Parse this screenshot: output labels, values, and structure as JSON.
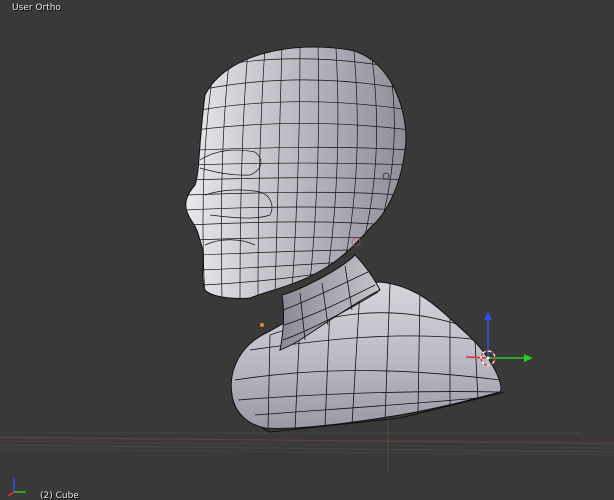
{
  "viewport": {
    "view_name": "User Ortho",
    "object_info": "(2) Cube",
    "background_color": "#393939"
  },
  "mesh": {
    "name": "Cube",
    "shading": "solid",
    "wireframe_overlay": true,
    "surface_color": "#c9c9cf",
    "wire_color": "#000000"
  },
  "transform_gizmo": {
    "x_axis_color": "#e03030",
    "y_axis_color": "#22cc22",
    "z_axis_color": "#2f4fe6"
  },
  "icons": {
    "gizmo": "transform-manipulator-icon",
    "origin": "object-origin-icon",
    "axis_widget": "view-axis-widget-icon",
    "cursor": "3d-cursor-icon"
  }
}
